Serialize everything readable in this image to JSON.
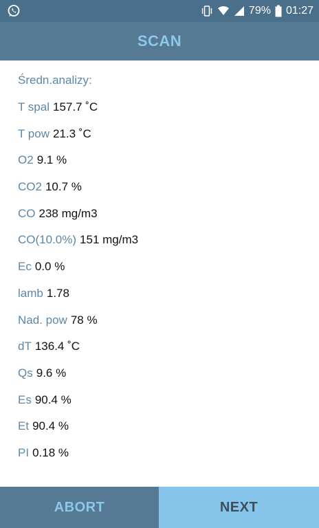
{
  "status_bar": {
    "left_icon": "whatsapp-icon",
    "icons": [
      "vibrate-icon",
      "wifi-icon",
      "signal-icon",
      "battery-icon"
    ],
    "battery": "79%",
    "time": "01:27"
  },
  "header": {
    "title": "SCAN"
  },
  "main": {
    "heading": "Średn.analizy:",
    "rows": [
      {
        "label": "T spal",
        "value": "157.7 ˚C"
      },
      {
        "label": "T pow",
        "value": "21.3 ˚C"
      },
      {
        "label": "O2",
        "value": "9.1 %"
      },
      {
        "label": "CO2",
        "value": "10.7 %"
      },
      {
        "label": "CO",
        "value": "238 mg/m3"
      },
      {
        "label": "CO(10.0%)",
        "value": "151 mg/m3"
      },
      {
        "label": "Ec",
        "value": "0.0 %"
      },
      {
        "label": "lamb",
        "value": "1.78"
      },
      {
        "label": "Nad. pow",
        "value": "78 %"
      },
      {
        "label": "dT",
        "value": "136.4 ˚C"
      },
      {
        "label": "Qs",
        "value": "9.6 %"
      },
      {
        "label": "Es",
        "value": "90.4 %"
      },
      {
        "label": "Et",
        "value": "90.4 %"
      },
      {
        "label": "PI",
        "value": "0.18 %"
      }
    ]
  },
  "footer": {
    "abort_label": "ABORT",
    "next_label": "NEXT"
  },
  "colors": {
    "status_bar_bg": "#4a6f8a",
    "title_bar_bg": "#577a94",
    "accent": "#8cc8ea",
    "label_text": "#5d87a6",
    "next_bg": "#87c5ea"
  }
}
